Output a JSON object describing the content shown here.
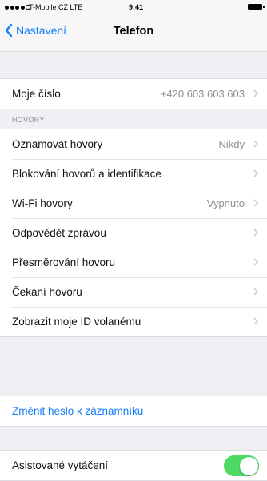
{
  "status_bar": {
    "carrier": "T-Mobile CZ  LTE",
    "time": "9:41"
  },
  "nav": {
    "back_label": "Nastavení",
    "title": "Telefon"
  },
  "my_number": {
    "label": "Moje číslo",
    "value": "+420 603 603 603"
  },
  "calls_section": {
    "header": "HOVORY",
    "items": [
      {
        "label": "Oznamovat hovory",
        "value": "Nikdy"
      },
      {
        "label": "Blokování hovorů a identifikace",
        "value": ""
      },
      {
        "label": "Wi-Fi hovory",
        "value": "Vypnuto"
      },
      {
        "label": "Odpovědět zprávou",
        "value": ""
      },
      {
        "label": "Přesměrování hovoru",
        "value": ""
      },
      {
        "label": "Čekání hovoru",
        "value": ""
      },
      {
        "label": "Zobrazit moje ID volanému",
        "value": ""
      }
    ]
  },
  "voicemail": {
    "change_password_label": "Změnit heslo k záznamníku"
  },
  "assisted_dialing": {
    "label": "Asistované vytáčení",
    "enabled": true
  },
  "colors": {
    "accent": "#147efb",
    "toggle_on": "#4cd964",
    "background": "#efeff4"
  }
}
